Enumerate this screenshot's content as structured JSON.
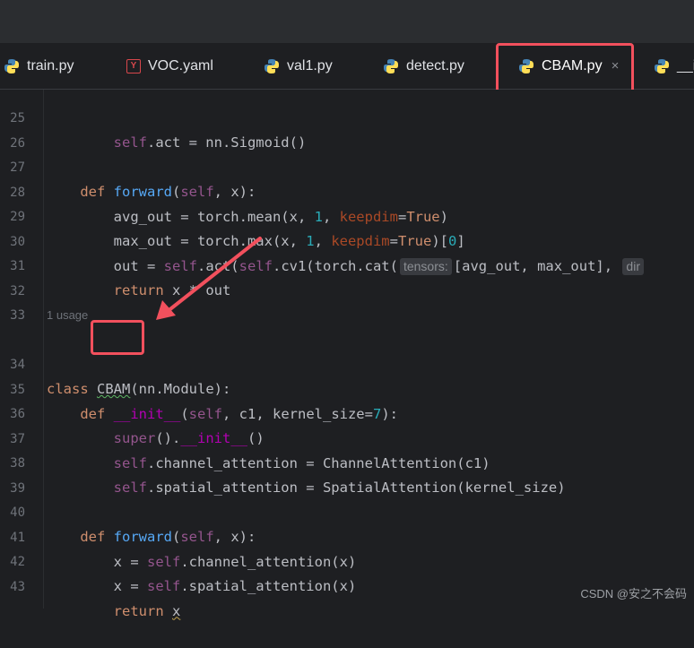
{
  "tabs": [
    {
      "label": "train.py",
      "icon": "python-icon"
    },
    {
      "label": "VOC.yaml",
      "icon": "yaml-icon"
    },
    {
      "label": "val1.py",
      "icon": "python-icon"
    },
    {
      "label": "detect.py",
      "icon": "python-icon"
    },
    {
      "label": "CBAM.py",
      "icon": "python-icon",
      "active": true,
      "close": "×"
    },
    {
      "label": "__i",
      "icon": "python-icon"
    }
  ],
  "editor": {
    "usage_hint": "1 usage",
    "inlay_hints": {
      "tensors": "tensors:",
      "dim": "dir"
    },
    "line_numbers": [
      "25",
      "26",
      "27",
      "28",
      "29",
      "30",
      "31",
      "32",
      "33",
      "34",
      "35",
      "36",
      "37",
      "38",
      "39",
      "40",
      "41",
      "42",
      "43"
    ]
  },
  "colors": {
    "accent": "#3574f0",
    "highlight": "#f2505d",
    "keyword": "#cf8e6d",
    "function": "#56a8f5"
  },
  "watermark": "CSDN @安之不会码"
}
